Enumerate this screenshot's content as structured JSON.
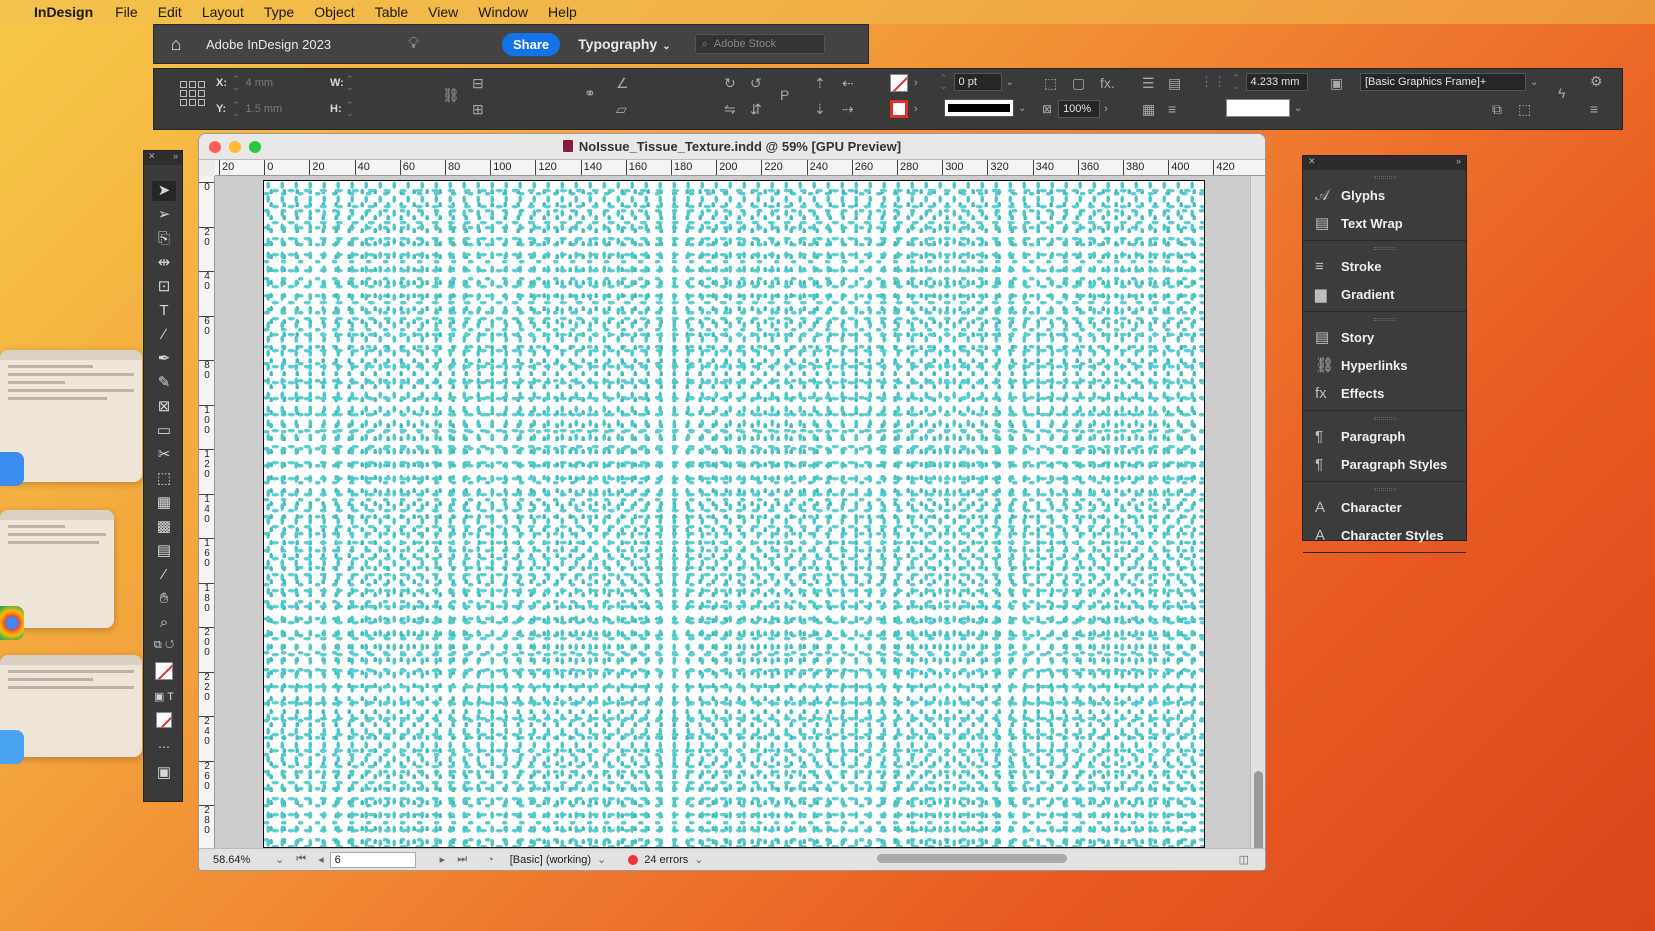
{
  "menubar": {
    "app_name": "InDesign",
    "items": [
      "File",
      "Edit",
      "Layout",
      "Type",
      "Object",
      "Table",
      "View",
      "Window",
      "Help"
    ]
  },
  "appbar": {
    "title": "Adobe InDesign 2023",
    "share_label": "Share",
    "workspace": "Typography",
    "search_placeholder": "Adobe Stock"
  },
  "control": {
    "x_label": "X:",
    "x_value": "4 mm",
    "y_label": "Y:",
    "y_value": "1.5 mm",
    "w_label": "W:",
    "h_label": "H:",
    "stroke_weight": "0 pt",
    "opacity": "100%",
    "dimension": "4.233 mm",
    "object_style": "[Basic Graphics Frame]+"
  },
  "document": {
    "title": "NoIssue_Tissue_Texture.indd @ 59% [GPU Preview]",
    "hruler_labels": [
      "20",
      "0",
      "20",
      "40",
      "60",
      "80",
      "100",
      "120",
      "140",
      "160",
      "180",
      "200",
      "220",
      "240",
      "260",
      "280",
      "300",
      "320",
      "340",
      "360",
      "380",
      "400",
      "420"
    ],
    "vruler_labels": [
      "0",
      "20",
      "40",
      "60",
      "80",
      "100",
      "120",
      "140",
      "160",
      "180",
      "200",
      "220",
      "240",
      "260",
      "280"
    ],
    "zoom": "58.64%",
    "page_number": "6",
    "preflight_profile": "[Basic] (working)",
    "errors": "24 errors",
    "pattern_color": "#4fc7c6"
  },
  "panels": {
    "groups": [
      [
        {
          "label": "Glyphs",
          "icon": "glyphs-icon"
        },
        {
          "label": "Text Wrap",
          "icon": "text-wrap-icon"
        }
      ],
      [
        {
          "label": "Stroke",
          "icon": "stroke-icon"
        },
        {
          "label": "Gradient",
          "icon": "gradient-icon"
        }
      ],
      [
        {
          "label": "Story",
          "icon": "story-icon"
        },
        {
          "label": "Hyperlinks",
          "icon": "hyperlinks-icon"
        },
        {
          "label": "Effects",
          "icon": "effects-icon"
        }
      ],
      [
        {
          "label": "Paragraph",
          "icon": "paragraph-icon"
        },
        {
          "label": "Paragraph Styles",
          "icon": "paragraph-styles-icon"
        }
      ],
      [
        {
          "label": "Character",
          "icon": "character-icon"
        },
        {
          "label": "Character Styles",
          "icon": "character-styles-icon"
        }
      ]
    ]
  },
  "colors": {
    "accent": "#1473e6",
    "error": "#ee3333",
    "panel_bg": "#3a3a3a"
  }
}
